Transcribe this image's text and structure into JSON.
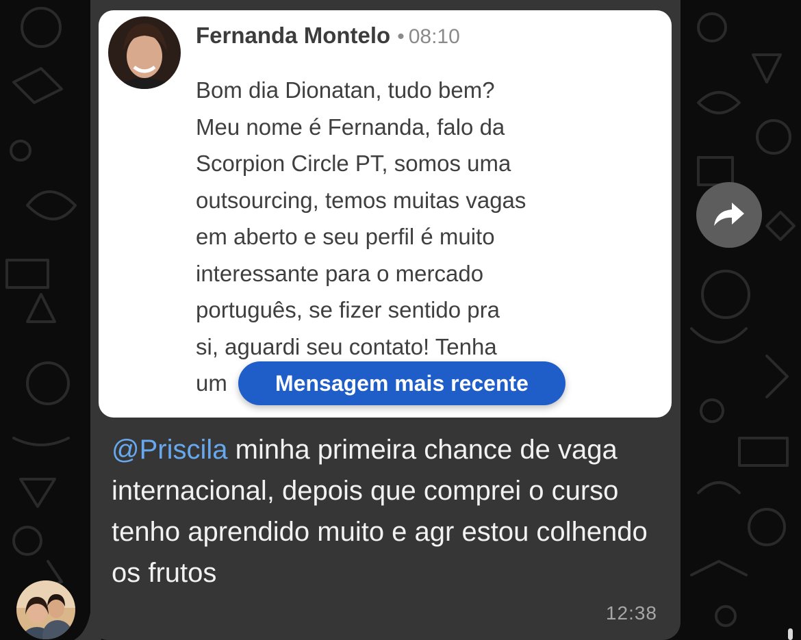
{
  "quoted_post": {
    "author_name": "Fernanda Montelo",
    "separator": "•",
    "time": "08:10",
    "lines": [
      "Bom dia Dionatan, tudo bem?",
      "Meu nome é Fernanda, falo da",
      "Scorpion Circle PT, somos uma",
      "outsourcing, temos muitas vagas",
      "em aberto e seu perfil é muito",
      "interessante para o mercado",
      "português, se fizer sentido pra",
      "si, aguardi seu contato! Tenha",
      "um"
    ],
    "recent_message_label": "Mensagem mais recente",
    "recent_message_color": "#1f5ec8"
  },
  "message": {
    "mention": "@Priscila",
    "text": " minha primeira chance de vaga internacional, depois que comprei o curso tenho aprendido muito e agr estou colhendo os frutos",
    "time": "12:38",
    "mention_color": "#68a8ee",
    "bubble_color": "#363636"
  },
  "icons": {
    "forward": "forward-arrow-icon",
    "author_avatar": "profile-photo-icon",
    "sender_avatar": "group-profile-photo-icon"
  }
}
